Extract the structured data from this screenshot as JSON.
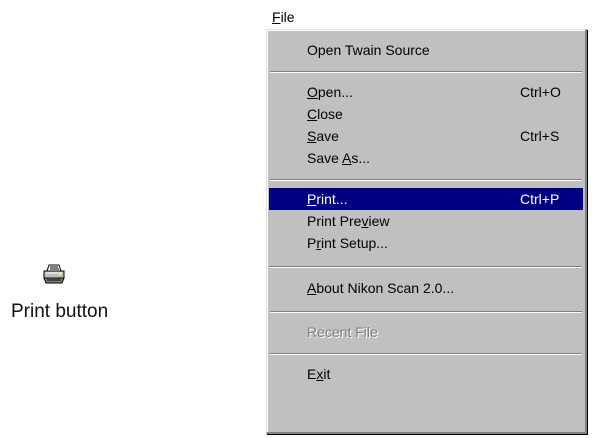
{
  "menubar": {
    "title_underlined": "F",
    "title_rest": "ile"
  },
  "colors": {
    "menu_bg": "#c0c0c0",
    "highlight": "#000080",
    "disabled": "#808080"
  },
  "menu": {
    "open_twain": "Open Twain Source",
    "open": {
      "ul": "O",
      "rest": "pen...",
      "shortcut": "Ctrl+O"
    },
    "close": {
      "ul": "C",
      "rest": "lose"
    },
    "save": {
      "ul": "S",
      "rest": "ave",
      "shortcut": "Ctrl+S"
    },
    "save_as": {
      "before": "Save ",
      "ul": "A",
      "rest": "s..."
    },
    "print": {
      "ul": "P",
      "rest": "rint...",
      "shortcut": "Ctrl+P"
    },
    "print_preview": {
      "before": "Print Pre",
      "ul": "v",
      "rest": "iew"
    },
    "print_setup": {
      "before": "P",
      "ul": "r",
      "rest": "int Setup..."
    },
    "about": {
      "ul": "A",
      "rest": "bout Nikon Scan 2.0..."
    },
    "recent_file": "Recent File",
    "exit": {
      "before": "E",
      "ul": "x",
      "rest": "it"
    }
  },
  "caption": "Print button",
  "icons": {
    "print": "printer-icon"
  }
}
